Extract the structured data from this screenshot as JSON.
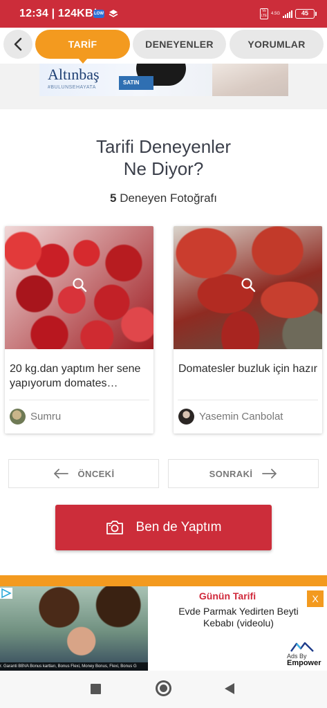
{
  "status_bar": {
    "time": "12:34",
    "speed": "124KB/s",
    "badge": "LOW",
    "volte": "Vo LTE",
    "network": "4.5G",
    "battery": "45"
  },
  "tabs": [
    {
      "label": "TARİF",
      "active": true
    },
    {
      "label": "DENEYENLER",
      "active": false
    },
    {
      "label": "YORUMLAR",
      "active": false
    }
  ],
  "top_ad": {
    "brand": "Altınbaş",
    "slogan": "#BULUNSEHAYATA",
    "button": "SATIN"
  },
  "section": {
    "title_line1": "Tarifi Deneyenler",
    "title_line2": "Ne Diyor?",
    "count": "5",
    "count_label": "Deneyen Fotoğrafı"
  },
  "cards": [
    {
      "caption": "20 kg.dan yaptım her sene yapıyorum domates…",
      "author": "Sumru"
    },
    {
      "caption": "Domatesler buzluk için hazır",
      "author": "Yasemin Canbolat"
    }
  ],
  "pagination": {
    "prev": "ÖNCEKİ",
    "next": "SONRAKİ"
  },
  "cta": {
    "label": "Ben de Yaptım"
  },
  "bottom_ad": {
    "heading": "Günün Tarifi",
    "recipe": "Evde Parmak Yedirten Beyti Kebabı (videolu)",
    "close": "X",
    "ads_by": "Ads By",
    "ads_brand": "Empower",
    "ticker": "r. Garanti BBVA Bonus kartları, Bonus Flexi, Money Bonus, Flexi, Bonus G"
  },
  "colors": {
    "brand_red": "#cc2d3a",
    "accent_orange": "#f39a1f"
  }
}
